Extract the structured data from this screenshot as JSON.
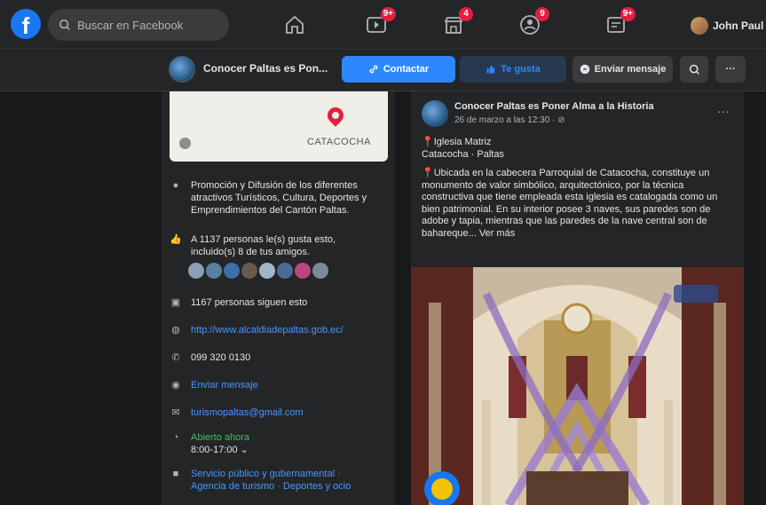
{
  "topbar": {
    "logo": "f",
    "search_placeholder": "Buscar en Facebook",
    "badges": {
      "watch": "9+",
      "marketplace": "4",
      "groups": "9",
      "gaming": "9+"
    },
    "profile_name": "John Paul"
  },
  "page": {
    "name": "Conocer Paltas es Pon...",
    "contact_label": "Contactar",
    "like_label": "Te gusta",
    "message_label": "Enviar mensaje"
  },
  "about": {
    "map_label": "CATACOCHA",
    "description": "Promoción y Difusión de los diferentes atractivos Turísticos, Cultura, Deportes y Emprendimientos del Cantón Paltas.",
    "likes": "A 1137 personas le(s) gusta esto, incluido(s) 8 de tus amigos.",
    "followers": "1167 personas siguen esto",
    "website": "http://www.alcaldiadepaltas.gob.ec/",
    "phone": "099 320 0130",
    "messenger": "Enviar mensaje",
    "email": "turismopaltas@gmail.com",
    "open_status": "Abierto ahora",
    "hours": "8:00-17:00",
    "categories": "Servicio público y gubernamental · Agencia de turismo · Deportes y ocio"
  },
  "post": {
    "author": "Conocer Paltas es Poner Alma a la Historia",
    "date": "26 de marzo a las 12:30 · ⊘",
    "location_line": "Iglesia Matriz",
    "location_sub": "Catacocha · Paltas",
    "body": "Ubicada en la cabecera Parroquial de Catacocha, constituye un monumento de valor simbólico, arquitectónico, por la técnica constructiva que tiene empleada esta iglesia es catalogada como un bien patrimonial. En su interior posee 3 naves, sus paredes son de adobe y tapia, mientras que las paredes de la nave central son de bahareque...",
    "see_more": "Ver más"
  },
  "colors": {
    "accent": "#2d88ff",
    "badge": "#e41e3f",
    "background": "#18191a",
    "surface": "#242526"
  }
}
